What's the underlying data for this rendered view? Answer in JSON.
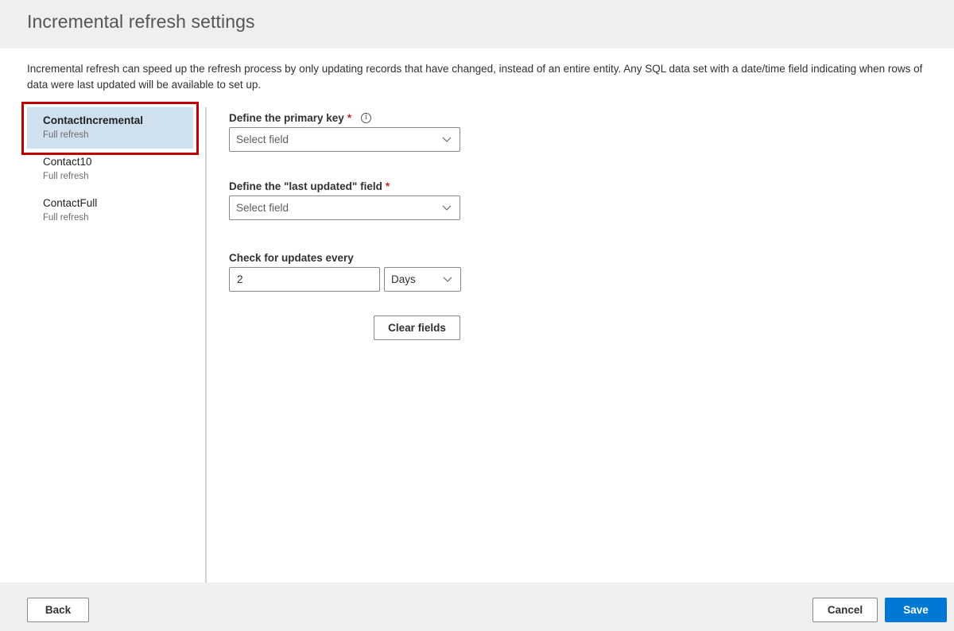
{
  "header": {
    "title": "Incremental refresh settings"
  },
  "description": "Incremental refresh can speed up the refresh process by only updating records that have changed, instead of an entire entity. Any SQL data set with a date/time field indicating when rows of data were last updated will be available to set up.",
  "entities": [
    {
      "name": "ContactIncremental",
      "status": "Full refresh",
      "selected": true
    },
    {
      "name": "Contact10",
      "status": "Full refresh",
      "selected": false
    },
    {
      "name": "ContactFull",
      "status": "Full refresh",
      "selected": false
    }
  ],
  "form": {
    "primary_key": {
      "label": "Define the primary key",
      "required_marker": "*",
      "info_icon": "info-icon",
      "placeholder": "Select field"
    },
    "last_updated": {
      "label": "Define the \"last updated\" field",
      "required_marker": "*",
      "placeholder": "Select field"
    },
    "interval": {
      "label": "Check for updates every",
      "value": "2",
      "unit": "Days"
    },
    "clear_label": "Clear fields"
  },
  "footer": {
    "back_label": "Back",
    "cancel_label": "Cancel",
    "save_label": "Save"
  },
  "colors": {
    "primary": "#0078d4",
    "selected_bg": "#cfe0ee",
    "highlight": "#c00000",
    "required": "#c4262e"
  }
}
